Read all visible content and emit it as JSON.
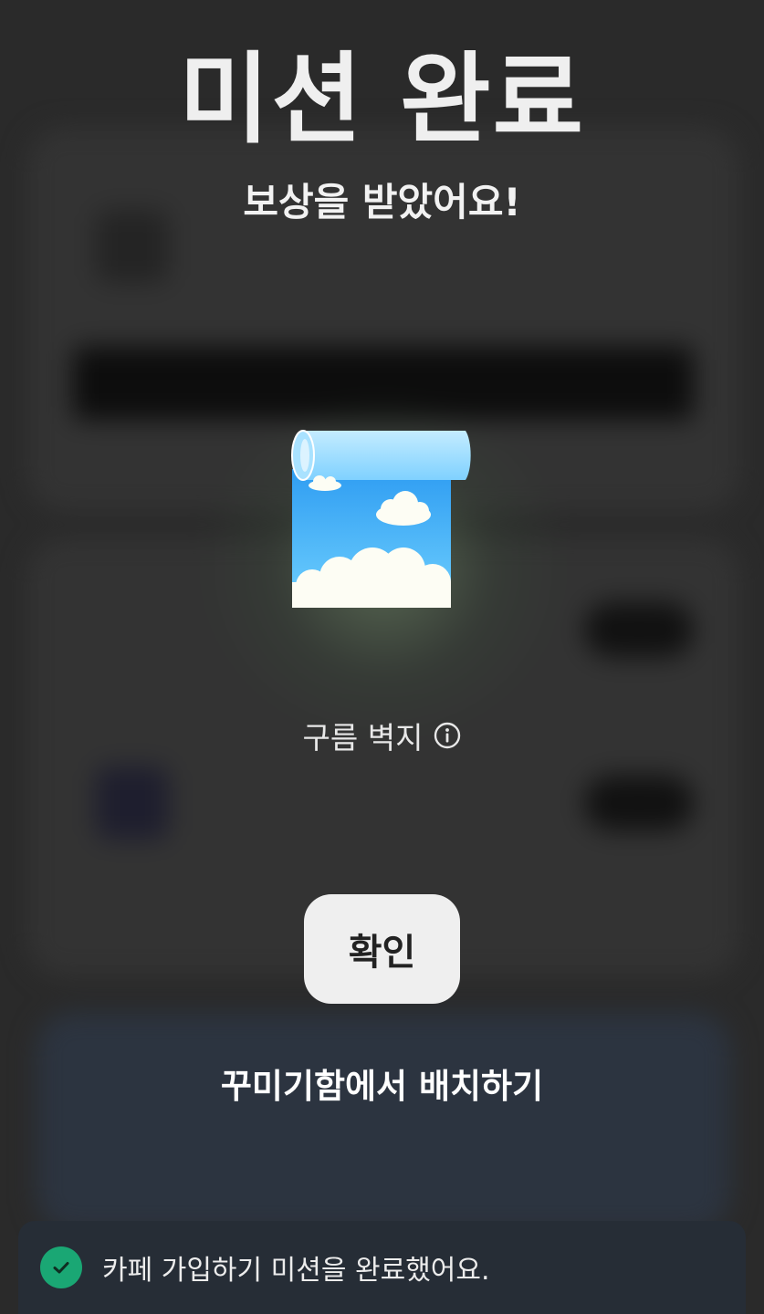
{
  "dialog": {
    "title": "미션 완료",
    "subtitle": "보상을 받았어요!",
    "reward": {
      "name": "구름 벽지",
      "image_icon": "cloud-wallpaper-scroll",
      "info_icon": "info-icon"
    },
    "confirm_label": "확인",
    "decorate_label": "꾸미기함에서 배치하기"
  },
  "toast": {
    "message": "카페 가입하기 미션을 완료했어요.",
    "icon": "check-circle-icon"
  },
  "colors": {
    "overlay_bg": "#2a2a2a",
    "button_bg": "#efefef",
    "toast_bg": "#262d36",
    "success_green": "#1aa774",
    "sky_blue": "#5bc4fb"
  }
}
